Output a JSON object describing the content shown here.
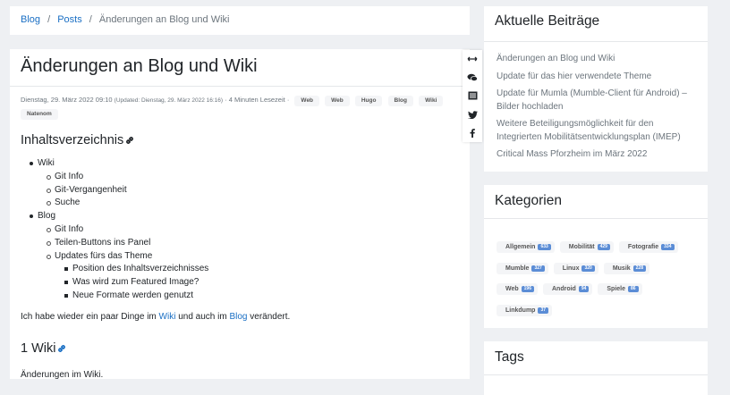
{
  "breadcrumb": {
    "items": [
      "Blog",
      "Posts"
    ],
    "current": "Änderungen an Blog und Wiki",
    "separator": "/"
  },
  "post": {
    "title": "Änderungen an Blog und Wiki",
    "date": "Dienstag, 29. März 2022 09:10",
    "updated": "(Updated: Dienstag, 29. März 2022 16:16)",
    "dot": "·",
    "reading_time": "4 Minuten Lesezeit",
    "tags": [
      "Web",
      "Web",
      "Hugo",
      "Blog",
      "Wiki",
      "Natenom"
    ],
    "toc_title": "Inhaltsverzeichnis",
    "toc": [
      {
        "label": "Wiki",
        "level": 1
      },
      {
        "label": "Git Info",
        "level": 2
      },
      {
        "label": "Git-Vergangenheit",
        "level": 2
      },
      {
        "label": "Suche",
        "level": 2
      },
      {
        "label": "Blog",
        "level": 1
      },
      {
        "label": "Git Info",
        "level": 2
      },
      {
        "label": "Teilen-Buttons ins Panel",
        "level": 2
      },
      {
        "label": "Updates fürs das Theme",
        "level": 2
      },
      {
        "label": "Position des Inhaltsverzeichnisses",
        "level": 3
      },
      {
        "label": "Was wird zum Featured Image?",
        "level": 3
      },
      {
        "label": "Neue Formate werden genutzt",
        "level": 3
      }
    ],
    "intro": {
      "before": "Ich habe wieder ein paar Dinge im ",
      "link1": "Wiki",
      "middle": " und auch im ",
      "link2": "Blog",
      "after": " verändert."
    },
    "section_heading": "1 Wiki",
    "section_text": "Änderungen im Wiki."
  },
  "share_icons": [
    "expand-arrows-icon",
    "comments-icon",
    "newsletter-icon",
    "twitter-icon",
    "facebook-icon"
  ],
  "sidebar": {
    "recent_title": "Aktuelle Beiträge",
    "recent_posts": [
      "Änderungen an Blog und Wiki",
      "Update für das hier verwendete Theme",
      "Update für Mumla (Mumble-Client für Android) – Bilder hochladen",
      "Weitere Beteiligungsmöglichkeit für den Integrierten Mobilitätsentwicklungsplan (IMEP)",
      "Critical Mass Pforzheim im März 2022"
    ],
    "categories_title": "Kategorien",
    "categories": [
      [
        {
          "name": "Allgemein",
          "count": "633"
        },
        {
          "name": "Mobilität",
          "count": "429"
        },
        {
          "name": "Fotografie",
          "count": "334"
        }
      ],
      [
        {
          "name": "Mumble",
          "count": "327"
        },
        {
          "name": "Linux",
          "count": "320"
        },
        {
          "name": "Musik",
          "count": "228"
        }
      ],
      [
        {
          "name": "Web",
          "count": "196"
        },
        {
          "name": "Android",
          "count": "94"
        },
        {
          "name": "Spiele",
          "count": "86"
        }
      ],
      [
        {
          "name": "Linkdump",
          "count": "37"
        }
      ]
    ],
    "tags_title": "Tags"
  },
  "colors": {
    "link": "#1a6fc4",
    "badge": "#5b8dd6",
    "background": "#eef0f3"
  }
}
